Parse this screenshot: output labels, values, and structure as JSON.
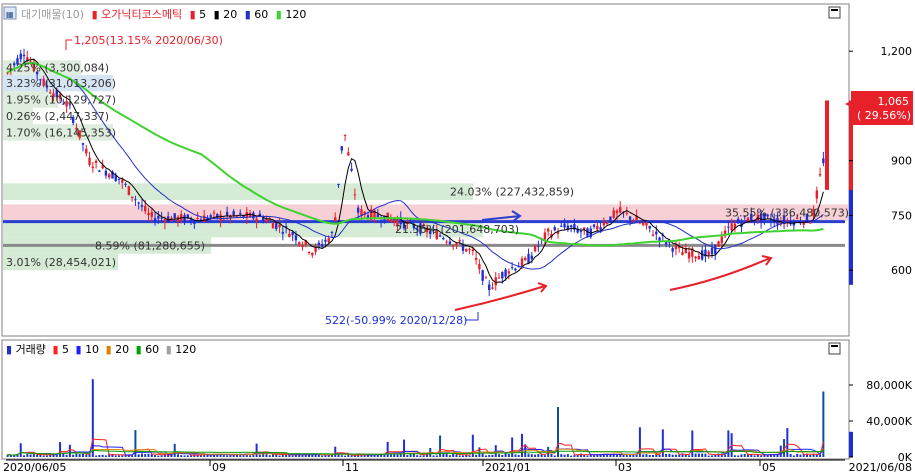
{
  "title_bar": {
    "stock_name": "오가닉티코스메틱",
    "prefix": "대기매물(10)",
    "ma_labels": [
      "5",
      "20",
      "60",
      "120"
    ]
  },
  "colors": {
    "up": "#e8202a",
    "down": "#1f2fd6",
    "ma5": "#000000",
    "ma20": "#2230c8",
    "ma60": "#3fd22f",
    "ma120": "#a0a0a0",
    "hline_blue": "#2a3fd0",
    "hline_gray": "#8a8a8a",
    "price_box": "#e8202a",
    "vol_ma5": "#ff2020",
    "vol_ma10": "#2020ff",
    "vol_ma20": "#e08000",
    "vol_ma60": "#00a000",
    "vol_ma120": "#a0a0a0"
  },
  "chart_data": {
    "type": "candlestick",
    "price_axis": {
      "ticks": [
        600,
        750,
        900,
        1200
      ],
      "tick_labels": [
        "600",
        "750",
        "900",
        "1,200"
      ],
      "range": [
        425,
        1280
      ]
    },
    "date_axis": {
      "start_label": "2020/06/05",
      "end_label": "2021/06/08",
      "tick_labels": [
        "09",
        "11",
        "2021/01",
        "03",
        "05"
      ]
    },
    "current_price": {
      "value": 1065,
      "label": "1,065",
      "change": "( 29.56%)"
    },
    "high_annotation": "1,205(13.15% 2020/06/30)",
    "low_annotation": "522(-50.99% 2020/12/28)",
    "supply_zones": [
      {
        "label": "4.25% (3,300,084)",
        "price_low": 1135,
        "price_high": 1175
      },
      {
        "label": "3.23% (31,013,206)",
        "price_low": 1090,
        "price_high": 1135
      },
      {
        "label": "1.95% (10,129,727)",
        "price_low": 1045,
        "price_high": 1090
      },
      {
        "label": "0.26% (2,447,337)",
        "price_low": 1000,
        "price_high": 1045
      },
      {
        "label": "1.70% (16,145,353)",
        "price_low": 955,
        "price_high": 1000
      },
      {
        "label": "24.03% (227,432,859)",
        "price_low": 792,
        "price_high": 838
      },
      {
        "label": "35.55% (336,480,573)",
        "price_low": 735,
        "price_high": 780
      },
      {
        "label": "21.36% (201,648,703)",
        "price_low": 690,
        "price_high": 735
      },
      {
        "label": "8.59% (81,280,655)",
        "price_low": 645,
        "price_high": 690
      },
      {
        "label": "3.01% (28,454,021)",
        "price_low": 600,
        "price_high": 645
      }
    ],
    "horizontal_lines": [
      733,
      668
    ],
    "volume": {
      "title": "거래량",
      "ma_labels": [
        "5",
        "10",
        "20",
        "60",
        "120"
      ],
      "ticks": [
        40000,
        80000
      ],
      "tick_labels": [
        "40,000K",
        "80,000K",
        "0K"
      ],
      "range": [
        0,
        110000
      ]
    }
  }
}
